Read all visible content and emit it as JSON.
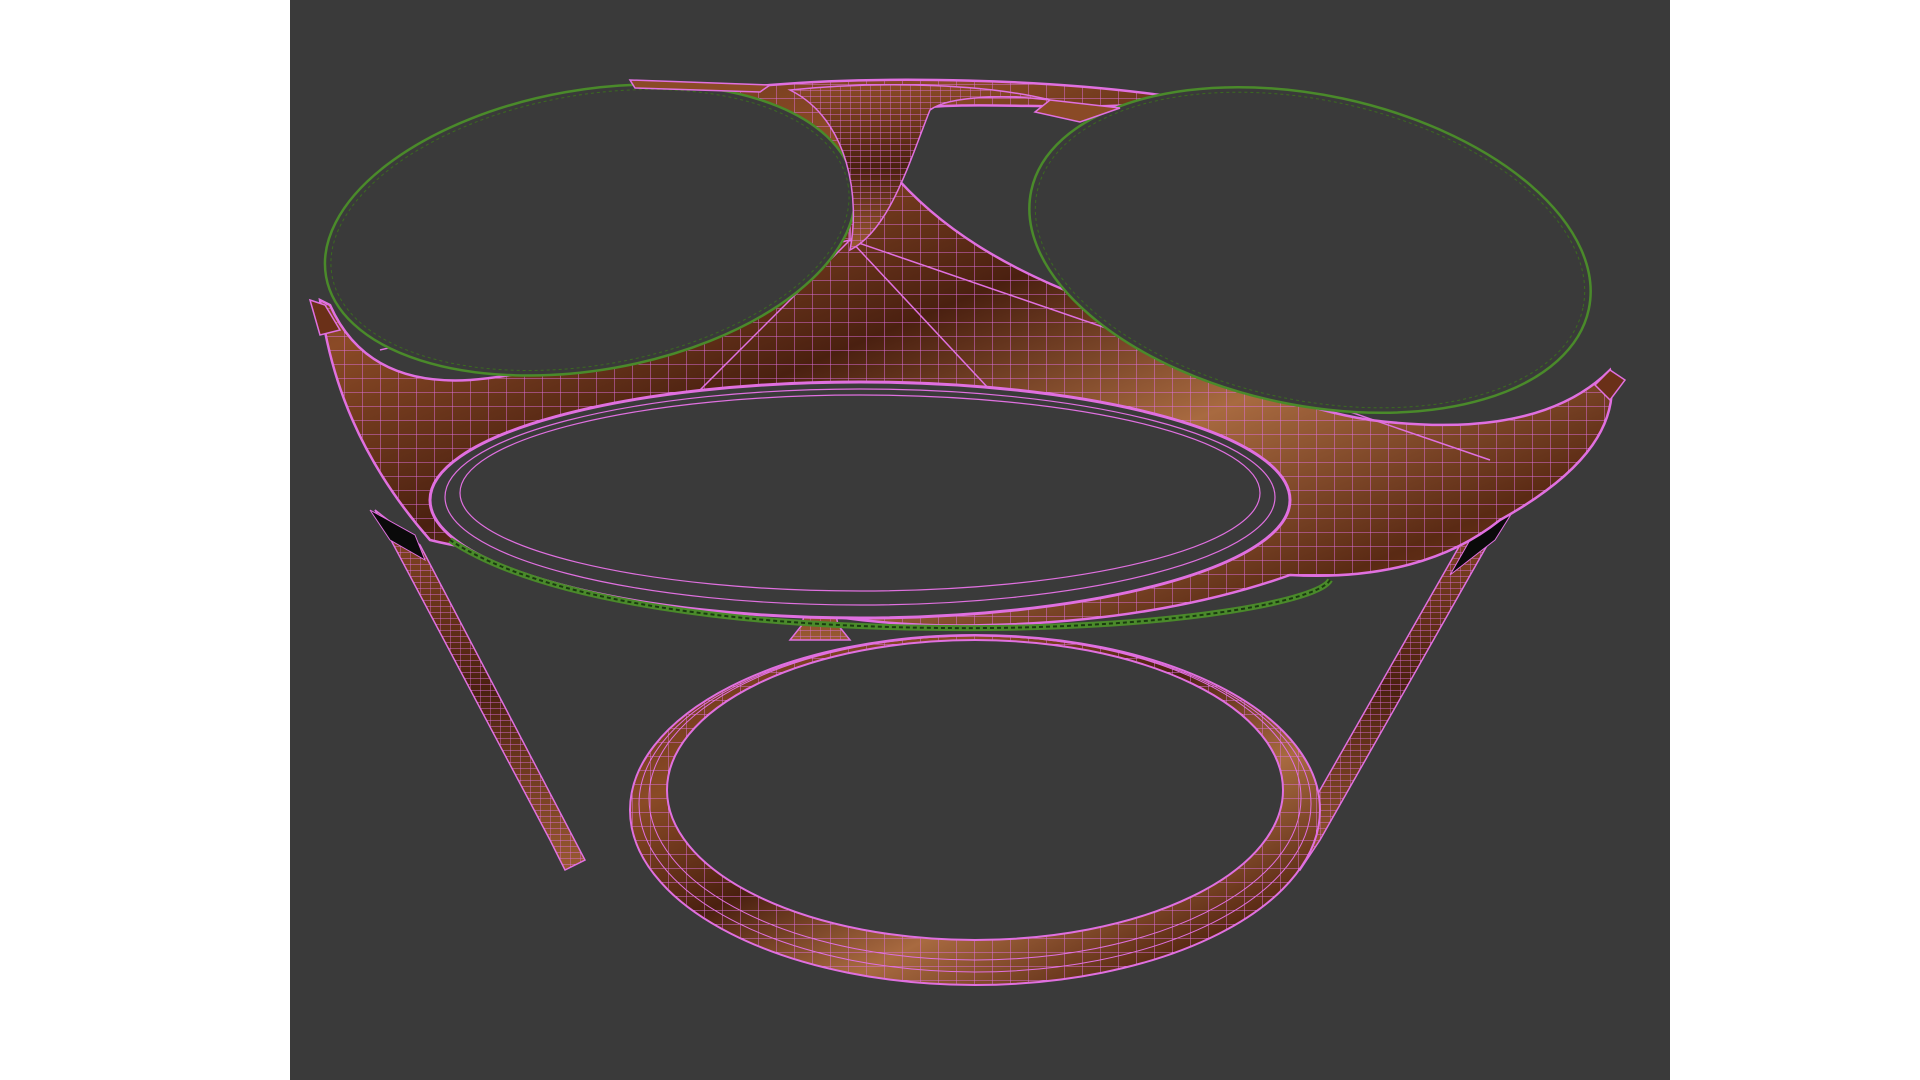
{
  "viewport": {
    "background": "#3a3a3a",
    "object": "table-model-wireframe",
    "shading": "wood-texture-with-wireframe-overlay",
    "wire_colors": {
      "selected_frame": "#e070e0",
      "glass_insets": "#4a8a2a"
    },
    "material": {
      "wood_dark": "#4a2414",
      "wood_mid": "#7a3c1e",
      "wood_light": "#b8764a"
    }
  }
}
